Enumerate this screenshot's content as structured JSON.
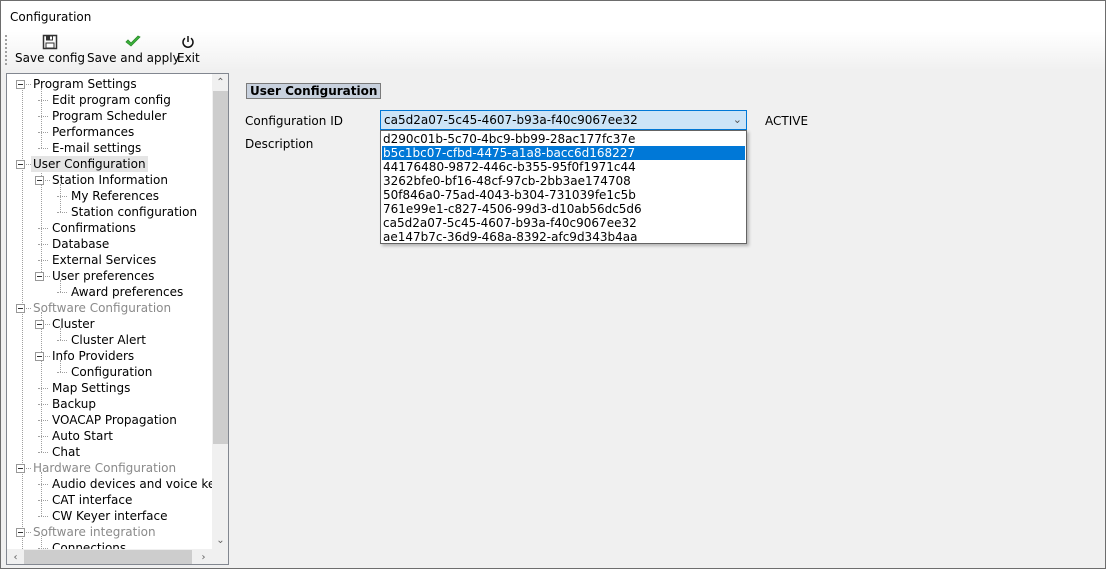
{
  "window": {
    "title": "Configuration"
  },
  "toolbar": {
    "buttons": [
      {
        "id": "save-config",
        "label": "Save config",
        "icon": "floppy-disk-icon"
      },
      {
        "id": "save-and-apply",
        "label": "Save and apply",
        "icon": "green-checkmark-icon"
      },
      {
        "id": "exit",
        "label": "Exit",
        "icon": "power-icon"
      }
    ]
  },
  "tree": {
    "items": [
      {
        "label": "Program Settings",
        "level": 0,
        "expander": true,
        "gray": false
      },
      {
        "label": "Edit program config",
        "level": 1
      },
      {
        "label": "Program Scheduler",
        "level": 1
      },
      {
        "label": "Performances",
        "level": 1
      },
      {
        "label": "E-mail settings",
        "level": 1
      },
      {
        "label": "User Configuration",
        "level": 0,
        "expander": true,
        "selected": true
      },
      {
        "label": "Station Information",
        "level": 1,
        "expander": true
      },
      {
        "label": "My References",
        "level": 2
      },
      {
        "label": "Station configuration",
        "level": 2
      },
      {
        "label": "Confirmations",
        "level": 1
      },
      {
        "label": "Database",
        "level": 1
      },
      {
        "label": "External Services",
        "level": 1
      },
      {
        "label": "User preferences",
        "level": 1,
        "expander": true
      },
      {
        "label": "Award preferences",
        "level": 2
      },
      {
        "label": "Software Configuration",
        "level": 0,
        "expander": true,
        "gray": true
      },
      {
        "label": "Cluster",
        "level": 1,
        "expander": true
      },
      {
        "label": "Cluster Alert",
        "level": 2
      },
      {
        "label": "Info Providers",
        "level": 1,
        "expander": true
      },
      {
        "label": "Configuration",
        "level": 2
      },
      {
        "label": "Map Settings",
        "level": 1
      },
      {
        "label": "Backup",
        "level": 1
      },
      {
        "label": "VOACAP Propagation",
        "level": 1
      },
      {
        "label": "Auto Start",
        "level": 1
      },
      {
        "label": "Chat",
        "level": 1
      },
      {
        "label": "Hardware Configuration",
        "level": 0,
        "expander": true,
        "gray": true
      },
      {
        "label": "Audio devices and voice keyer",
        "level": 1
      },
      {
        "label": "CAT interface",
        "level": 1
      },
      {
        "label": "CW Keyer interface",
        "level": 1
      },
      {
        "label": "Software integration",
        "level": 0,
        "expander": true,
        "gray": true
      },
      {
        "label": "Connections",
        "level": 1
      }
    ]
  },
  "main": {
    "section_title": "User Configuration",
    "config_id_label": "Configuration ID",
    "description_label": "Description",
    "config_id_value": "ca5d2a07-5c45-4607-b93a-f40c9067ee32",
    "status": "ACTIVE",
    "dropdown_options": [
      "d290c01b-5c70-4bc9-bb99-28ac177fc37e",
      "b5c1bc07-cfbd-4475-a1a8-bacc6d168227",
      "44176480-9872-446c-b355-95f0f1971c44",
      "3262bfe0-bf16-48cf-97cb-2bb3ae174708",
      "50f846a0-75ad-4043-b304-731039fe1c5b",
      "761e99e1-c827-4506-99d3-d10ab56dc5d6",
      "ca5d2a07-5c45-4607-b93a-f40c9067ee32",
      "ae147b7c-36d9-468a-8392-afc9d343b4aa"
    ],
    "highlighted_option_index": 1
  }
}
